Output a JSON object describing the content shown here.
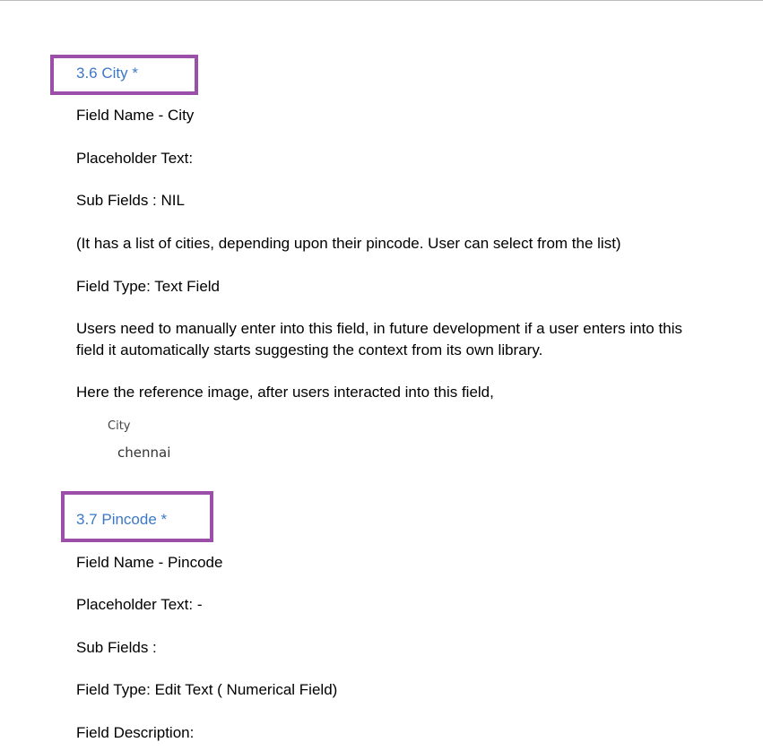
{
  "section_city": {
    "heading": "3.6  City *",
    "field_name": "Field Name -  City",
    "placeholder": "Placeholder Text:",
    "sub_fields": "Sub Fields :  NIL",
    "note": "(It has a list of cities, depending upon their pincode. User can select from the list)",
    "field_type": "Field Type:  Text Field",
    "description": "Users need to manually enter into this field, in future development if a user enters into this field it automatically starts suggesting the context from its own library.",
    "reference_intro": "Here the reference image, after users interacted into this field,",
    "reference_label": "City",
    "reference_value": "chennai"
  },
  "section_pincode": {
    "heading": "3.7  Pincode *",
    "field_name": "Field Name -  Pincode",
    "placeholder": "Placeholder Text: -",
    "sub_fields": "Sub Fields :",
    "field_type": "Field Type:  Edit Text ( Numerical Field)",
    "field_description": "Field Description:"
  },
  "colors": {
    "heading_text": "#3d78c4",
    "highlight_box": "#9b4fa8"
  }
}
